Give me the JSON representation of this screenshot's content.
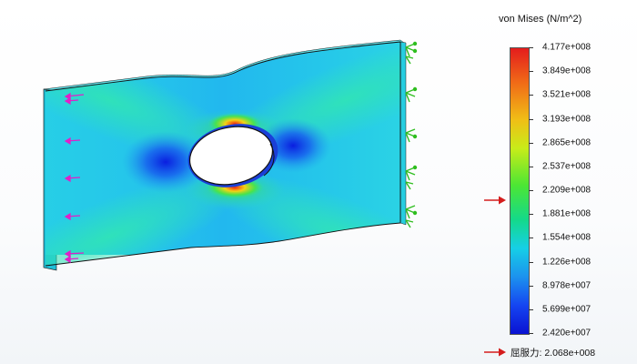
{
  "legend": {
    "title": "von Mises (N/m^2)",
    "ticks": [
      "4.177e+008",
      "3.849e+008",
      "3.521e+008",
      "3.193e+008",
      "2.865e+008",
      "2.537e+008",
      "2.209e+008",
      "1.881e+008",
      "1.554e+008",
      "1.226e+008",
      "8.978e+007",
      "5.699e+007",
      "2.420e+007"
    ],
    "max": 417700000.0,
    "min": 24200000.0,
    "yield_marker_value": 206800000.0
  },
  "yield": {
    "label": "屈服力: 2.068e+008"
  },
  "colors": {
    "marker_arrow": "#d41c1c",
    "load_arrow": "#e020c8",
    "fixture": "#2fbe1f"
  }
}
